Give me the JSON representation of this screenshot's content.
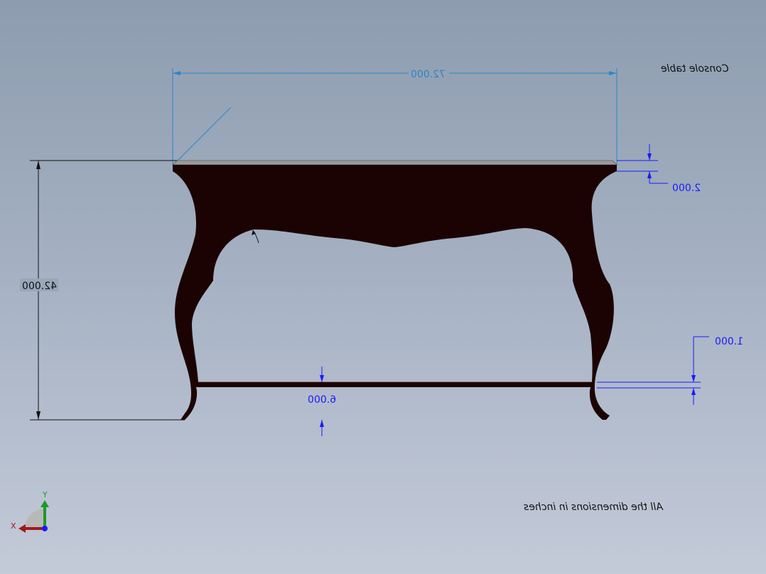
{
  "title": "Console table",
  "note": "All the dimensions in inches",
  "dimensions": {
    "overall_width": "72.000",
    "overall_height": "42.000",
    "top_thickness": "2.000",
    "stretcher_height": "6.000",
    "stretcher_thickness": "1.000"
  },
  "triad": {
    "x_label": "X",
    "y_label": "Y"
  },
  "colors": {
    "wood": "#1c0303",
    "top_surface": "#9a9a9a",
    "dim_blue": "#1a1aff",
    "dim_cyan": "#2b86c9"
  }
}
